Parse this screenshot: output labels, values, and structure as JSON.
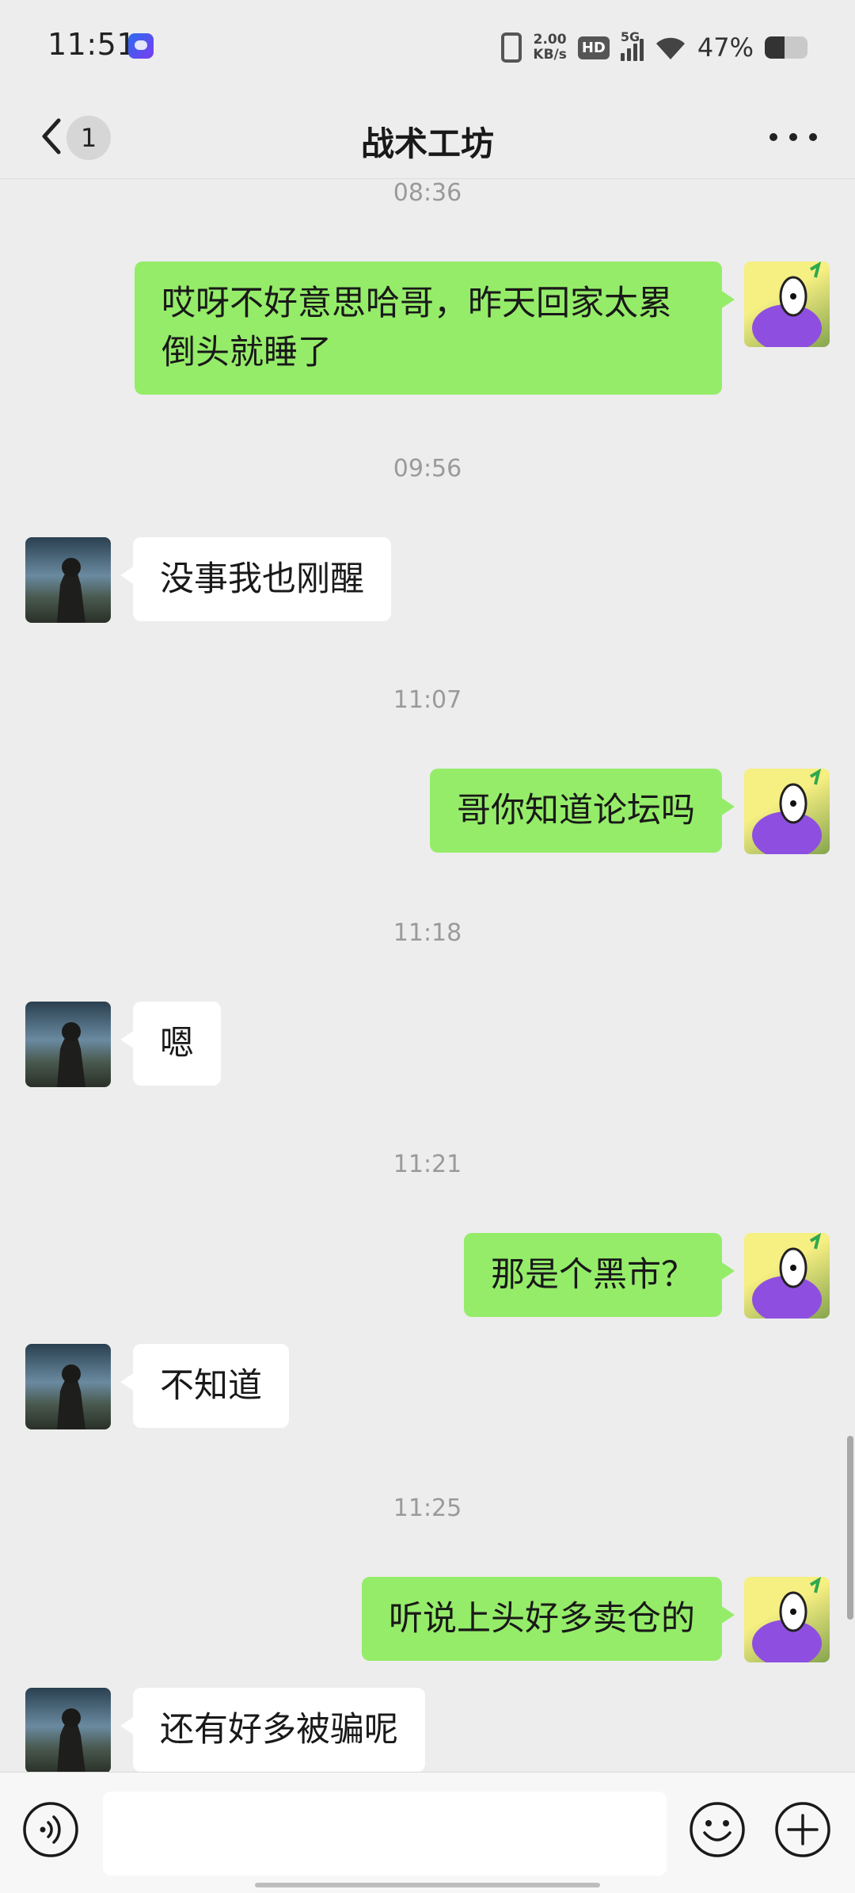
{
  "status_bar": {
    "time": "11:51",
    "net_speed_value": "2.00",
    "net_speed_unit": "KB/s",
    "hd_label": "HD",
    "network_label": "5G",
    "battery_text": "47%",
    "battery_level": 0.47
  },
  "nav": {
    "unread_count": "1",
    "title": "战术工坊",
    "icons": [
      "back-arrow-icon",
      "more-dots-icon"
    ]
  },
  "colors": {
    "background": "#ededed",
    "bubble_me": "#95ec69",
    "bubble_other": "#ffffff",
    "timestamp": "#9a9a9a"
  },
  "chat": {
    "timestamps": [
      "08:36",
      "09:56",
      "11:07",
      "11:18",
      "11:21",
      "11:25"
    ],
    "messages": [
      {
        "sender": "me",
        "text": "哎呀不好意思哈哥，昨天回家太累倒头就睡了"
      },
      {
        "sender": "other",
        "text": "没事我也刚醒"
      },
      {
        "sender": "me",
        "text": "哥你知道论坛吗"
      },
      {
        "sender": "other",
        "text": "嗯"
      },
      {
        "sender": "me",
        "text": "那是个黑市？"
      },
      {
        "sender": "other",
        "text": "不知道"
      },
      {
        "sender": "me",
        "text": "听说上头好多卖仓的"
      },
      {
        "sender": "other",
        "text": "还有好多被骗呢"
      }
    ]
  },
  "input_bar": {
    "icons": [
      "voice-icon",
      "emoji-icon",
      "plus-icon"
    ]
  }
}
